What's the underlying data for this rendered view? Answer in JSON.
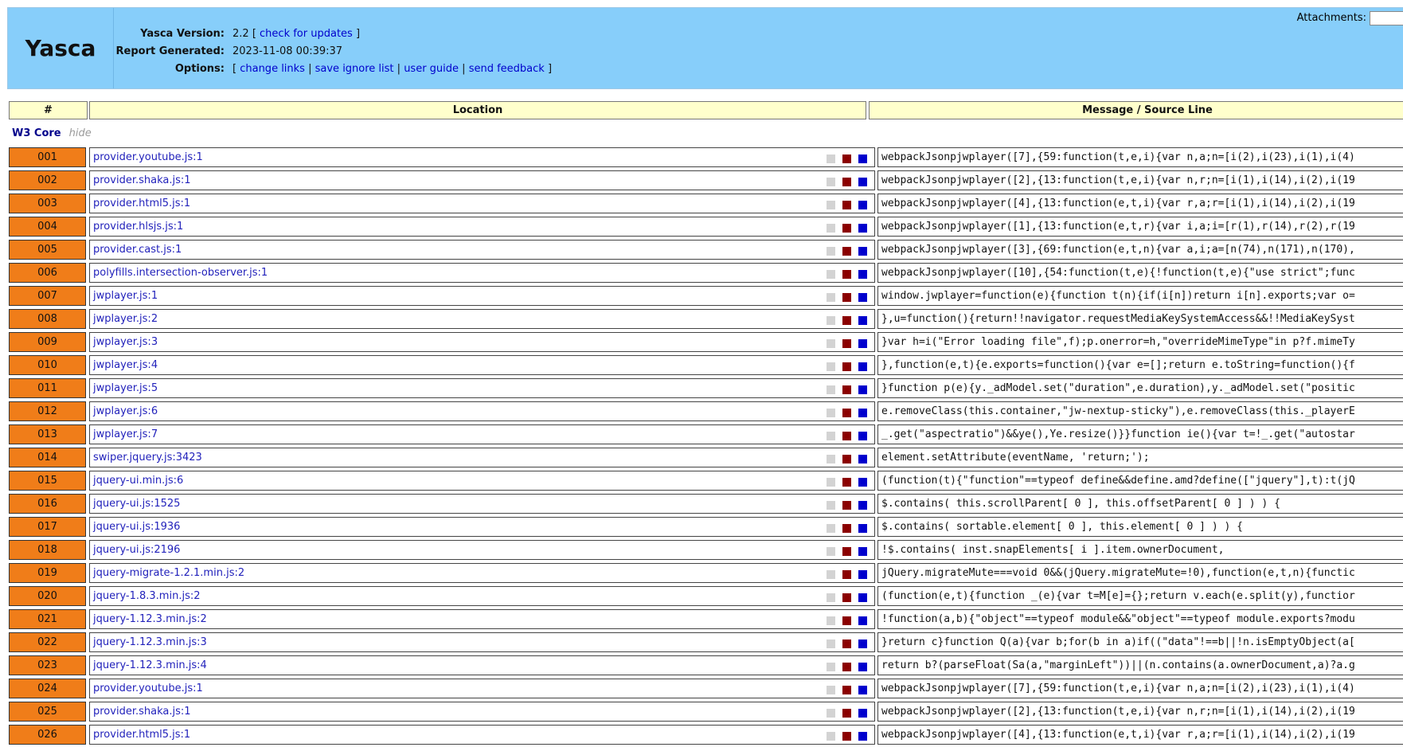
{
  "header": {
    "logo": "Yasca",
    "version_label": "Yasca Version:",
    "version_value": "2.2",
    "check_updates_label": "check for updates",
    "report_label": "Report Generated:",
    "report_value": "2023-11-08 00:39:37",
    "options_label": "Options:",
    "options": [
      "change links",
      "save ignore list",
      "user guide",
      "send feedback"
    ],
    "attachments_label": "Attachments:"
  },
  "table": {
    "columns": [
      "#",
      "Location",
      "Message / Source Line"
    ],
    "group": {
      "name": "W3 Core",
      "hide_label": "hide"
    },
    "rows": [
      {
        "num": "001",
        "location": "provider.youtube.js:1",
        "message": "webpackJsonpjwplayer([7],{59:function(t,e,i){var n,a;n=[i(2),i(23),i(1),i(4)"
      },
      {
        "num": "002",
        "location": "provider.shaka.js:1",
        "message": "webpackJsonpjwplayer([2],{13:function(t,e,i){var n,r;n=[i(1),i(14),i(2),i(19"
      },
      {
        "num": "003",
        "location": "provider.html5.js:1",
        "message": "webpackJsonpjwplayer([4],{13:function(e,t,i){var r,a;r=[i(1),i(14),i(2),i(19"
      },
      {
        "num": "004",
        "location": "provider.hlsjs.js:1",
        "message": "webpackJsonpjwplayer([1],{13:function(e,t,r){var i,a;i=[r(1),r(14),r(2),r(19"
      },
      {
        "num": "005",
        "location": "provider.cast.js:1",
        "message": "webpackJsonpjwplayer([3],{69:function(e,t,n){var a,i;a=[n(74),n(171),n(170),"
      },
      {
        "num": "006",
        "location": "polyfills.intersection-observer.js:1",
        "message": "webpackJsonpjwplayer([10],{54:function(t,e){!function(t,e){\"use strict\";func"
      },
      {
        "num": "007",
        "location": "jwplayer.js:1",
        "message": "window.jwplayer=function(e){function t(n){if(i[n])return i[n].exports;var o="
      },
      {
        "num": "008",
        "location": "jwplayer.js:2",
        "message": "},u=function(){return!!navigator.requestMediaKeySystemAccess&&!!MediaKeySyst"
      },
      {
        "num": "009",
        "location": "jwplayer.js:3",
        "message": "}var h=i(\"Error loading file\",f);p.onerror=h,\"overrideMimeType\"in p?f.mimeTy"
      },
      {
        "num": "010",
        "location": "jwplayer.js:4",
        "message": "},function(e,t){e.exports=function(){var e=[];return e.toString=function(){f"
      },
      {
        "num": "011",
        "location": "jwplayer.js:5",
        "message": "}function p(e){y._adModel.set(\"duration\",e.duration),y._adModel.set(\"positic"
      },
      {
        "num": "012",
        "location": "jwplayer.js:6",
        "message": "e.removeClass(this.container,\"jw-nextup-sticky\"),e.removeClass(this._playerE"
      },
      {
        "num": "013",
        "location": "jwplayer.js:7",
        "message": "_.get(\"aspectratio\")&&ye(),Ye.resize()}}function ie(){var t=!_.get(\"autostar"
      },
      {
        "num": "014",
        "location": "swiper.jquery.js:3423",
        "message": "element.setAttribute(eventName, 'return;');"
      },
      {
        "num": "015",
        "location": "jquery-ui.min.js:6",
        "message": "(function(t){\"function\"==typeof define&&define.amd?define([\"jquery\"],t):t(jQ"
      },
      {
        "num": "016",
        "location": "jquery-ui.js:1525",
        "message": "$.contains( this.scrollParent[ 0 ], this.offsetParent[ 0 ] ) ) {"
      },
      {
        "num": "017",
        "location": "jquery-ui.js:1936",
        "message": "$.contains( sortable.element[ 0 ], this.element[ 0 ] ) ) {"
      },
      {
        "num": "018",
        "location": "jquery-ui.js:2196",
        "message": "!$.contains( inst.snapElements[ i ].item.ownerDocument,"
      },
      {
        "num": "019",
        "location": "jquery-migrate-1.2.1.min.js:2",
        "message": "jQuery.migrateMute===void 0&&(jQuery.migrateMute=!0),function(e,t,n){functic"
      },
      {
        "num": "020",
        "location": "jquery-1.8.3.min.js:2",
        "message": "(function(e,t){function _(e){var t=M[e]={};return v.each(e.split(y),functior"
      },
      {
        "num": "021",
        "location": "jquery-1.12.3.min.js:2",
        "message": "!function(a,b){\"object\"==typeof module&&\"object\"==typeof module.exports?modu"
      },
      {
        "num": "022",
        "location": "jquery-1.12.3.min.js:3",
        "message": "}return c}function Q(a){var b;for(b in a)if((\"data\"!==b||!n.isEmptyObject(a["
      },
      {
        "num": "023",
        "location": "jquery-1.12.3.min.js:4",
        "message": "return b?(parseFloat(Sa(a,\"marginLeft\"))||(n.contains(a.ownerDocument,a)?a.g"
      },
      {
        "num": "024",
        "location": "provider.youtube.js:1",
        "message": "webpackJsonpjwplayer([7],{59:function(t,e,i){var n,a;n=[i(2),i(23),i(1),i(4)"
      },
      {
        "num": "025",
        "location": "provider.shaka.js:1",
        "message": "webpackJsonpjwplayer([2],{13:function(t,e,i){var n,r;n=[i(1),i(14),i(2),i(19"
      },
      {
        "num": "026",
        "location": "provider.html5.js:1",
        "message": "webpackJsonpjwplayer([4],{13:function(e,t,i){var r,a;r=[i(1),i(14),i(2),i(19"
      }
    ]
  },
  "colors": {
    "header_bg": "#87cefa",
    "number_cell_bg": "#f07d19",
    "column_header_bg": "#ffffcc",
    "square_gray": "#d3d3d3",
    "square_red": "#8b0000",
    "square_blue": "#0000cd",
    "link": "#2222bb"
  }
}
